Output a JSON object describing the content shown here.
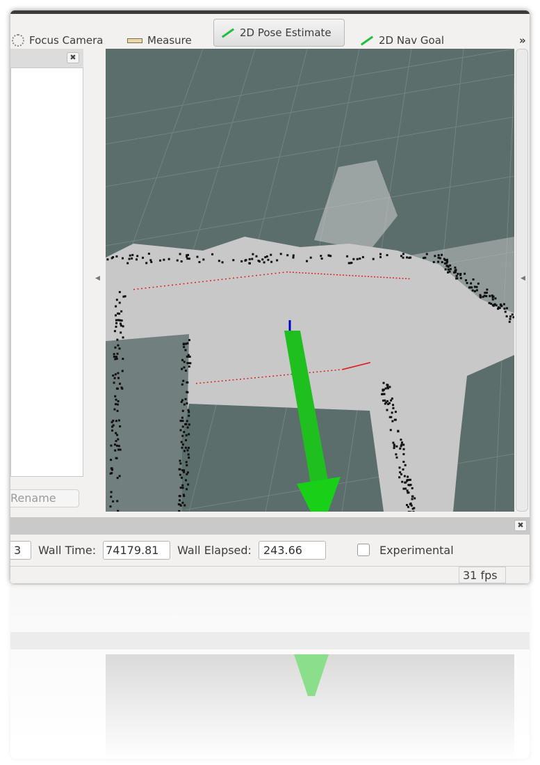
{
  "toolbar": {
    "tools": [
      {
        "label": "Focus Camera",
        "icon": "focus-camera-icon"
      },
      {
        "label": "Measure",
        "icon": "ruler-icon"
      },
      {
        "label": "2D Pose Estimate",
        "icon": "green-arrow-icon",
        "active": true
      },
      {
        "label": "2D Nav Goal",
        "icon": "green-arrow-icon"
      }
    ],
    "overflow": "»"
  },
  "left_panel": {
    "rename_label": "Rename"
  },
  "time_panel": {
    "ros_elapsed_partial": "3",
    "wall_time_label": "Wall Time:",
    "wall_time_value": "74179.81",
    "wall_elapsed_label": "Wall Elapsed:",
    "wall_elapsed_value": "243.66",
    "experimental_label": "Experimental",
    "experimental_checked": false
  },
  "status": {
    "fps": "31 fps"
  },
  "colors": {
    "background": "#5b6e6b",
    "floor": "#c8c8c8",
    "pose_arrow": "#1fbf1f",
    "laser": "#e02020"
  }
}
